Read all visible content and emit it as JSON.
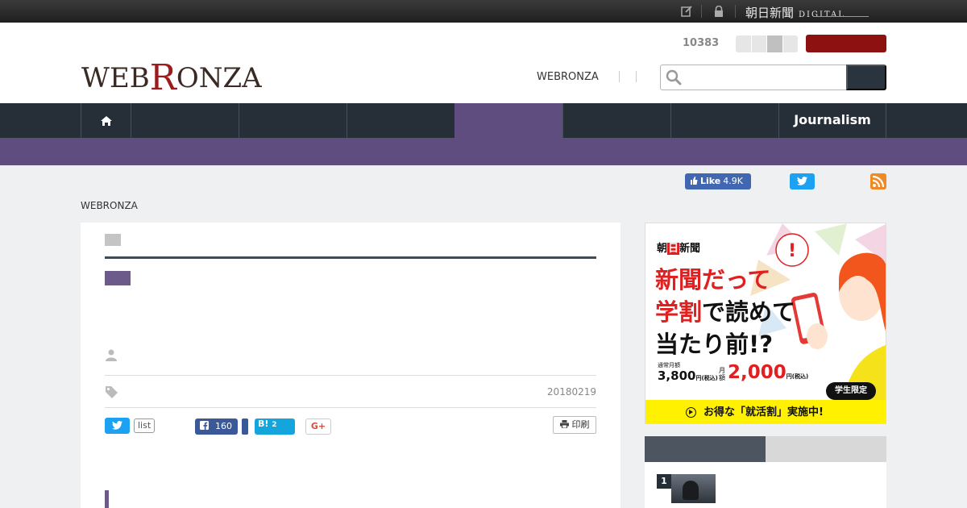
{
  "topbar": {
    "edit_icon": "edit-icon",
    "lock_icon": "lock-icon",
    "logo_text": "朝日新聞",
    "logo_digital": "DIGITAL"
  },
  "header": {
    "logo_pre": "WEB",
    "logo_r": "R",
    "logo_post": "ONZA",
    "count": "10383",
    "nav_link": "WEBRONZA",
    "search_placeholder": ""
  },
  "nav": {
    "home_icon": "home-icon",
    "journalism_label": "Journalism"
  },
  "social": {
    "fb_like_label": "Like",
    "fb_like_count": "4.9K"
  },
  "breadcrumb": "WEBRONZA",
  "article": {
    "date": "20180219",
    "share_list_label": "list",
    "fb_share_count": "160",
    "hatena_label": "B!",
    "hatena_count": "2",
    "gplus_label": "G+",
    "print_label": "印刷"
  },
  "ad": {
    "brand_pre": "朝",
    "brand_sun": "日",
    "brand_post": "新聞",
    "line1": "新聞だって",
    "line2_red": "学割",
    "line2_rest": "で読めて",
    "line3": "当たり前!?",
    "regular_label": "通常月額",
    "regular_price": "3,800",
    "yen_tax": "円(税込)",
    "monthly_label": "月額",
    "student_price": "2,000",
    "student_badge": "学生限定",
    "footer": "お得な「就活割」実施中!"
  },
  "ranking": {
    "first_number": "1"
  },
  "colors": {
    "nav_dark": "#262f38",
    "accent_purple": "#5e4d7e",
    "brand_red": "#8e1111",
    "twitter": "#1da1f2",
    "facebook": "#3b5998"
  }
}
